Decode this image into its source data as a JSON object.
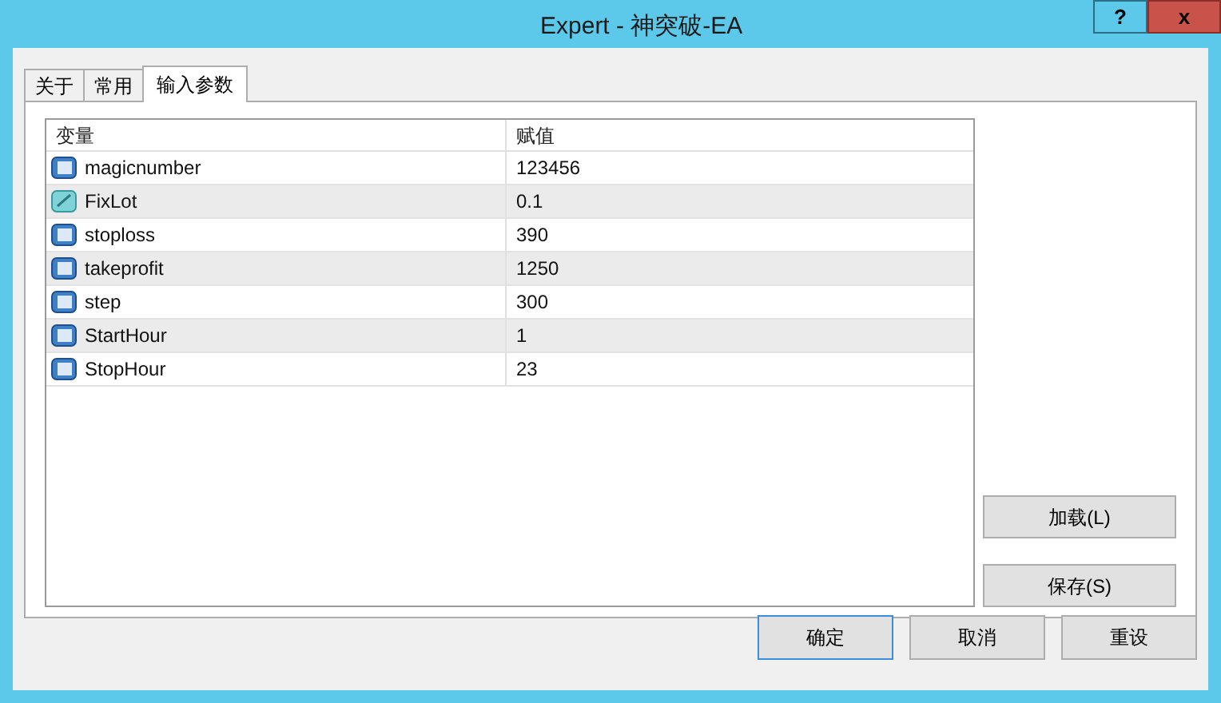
{
  "window": {
    "title": "Expert - 神突破-EA",
    "help_button": "?",
    "close_button": "x"
  },
  "tabs": [
    {
      "label": "关于",
      "selected": false
    },
    {
      "label": "常用",
      "selected": false
    },
    {
      "label": "输入参数",
      "selected": true
    }
  ],
  "table": {
    "columns": [
      "变量",
      "赋值"
    ],
    "rows": [
      {
        "kind": "integer",
        "name": "magicnumber",
        "value": "123456"
      },
      {
        "kind": "double",
        "name": "FixLot",
        "value": "0.1"
      },
      {
        "kind": "integer",
        "name": "stoploss",
        "value": "390"
      },
      {
        "kind": "integer",
        "name": "takeprofit",
        "value": "1250"
      },
      {
        "kind": "integer",
        "name": "step",
        "value": "300"
      },
      {
        "kind": "integer",
        "name": "StartHour",
        "value": "1"
      },
      {
        "kind": "integer",
        "name": "StopHour",
        "value": "23"
      }
    ]
  },
  "side_buttons": [
    "加载(L)",
    "保存(S)"
  ],
  "buttons": [
    {
      "label": "确定",
      "default": true
    },
    {
      "label": "取消",
      "default": false
    },
    {
      "label": "重设",
      "default": false
    }
  ]
}
